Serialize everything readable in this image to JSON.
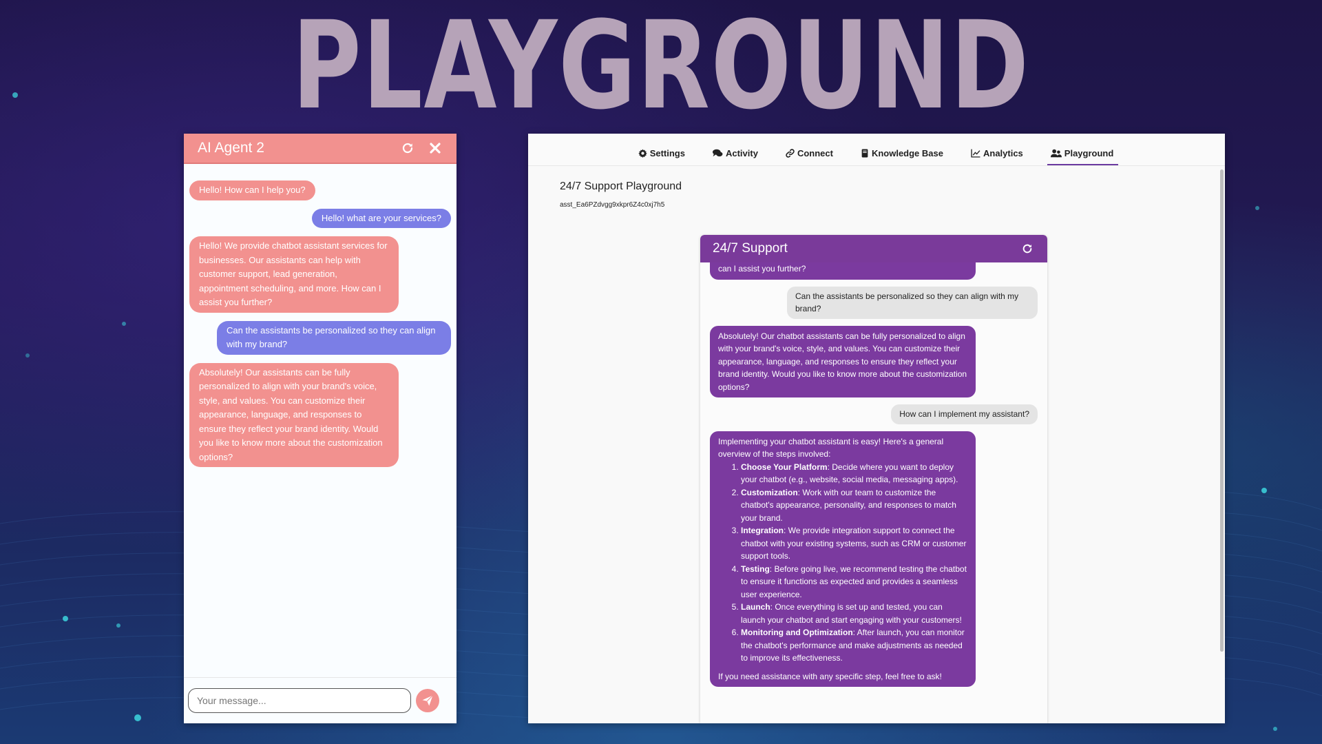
{
  "hero": {
    "title": "PLAYGROUND"
  },
  "agent_widget": {
    "title": "AI Agent 2",
    "refresh_icon": "refresh-icon",
    "close_icon": "close-icon",
    "accent_color": "#f2918f",
    "user_color": "#7b7ee6",
    "messages": [
      {
        "role": "bot",
        "text": "Hello! How can I help you?"
      },
      {
        "role": "user",
        "text": "Hello! what are your services?"
      },
      {
        "role": "bot",
        "text": "Hello! We provide chatbot assistant services for businesses. Our assistants can help with customer support, lead generation, appointment scheduling, and more. How can I assist you further?"
      },
      {
        "role": "user",
        "text": "Can the assistants be personalized so they can align with my brand?"
      },
      {
        "role": "bot",
        "text": "Absolutely! Our assistants can be fully personalized to align with your brand's voice, style, and values. You can customize their appearance, language, and responses to ensure they reflect your brand identity. Would you like to know more about the customization options?"
      }
    ],
    "input_placeholder": "Your message...",
    "send_icon": "send-icon"
  },
  "panel": {
    "nav": [
      {
        "label": "Settings",
        "icon": "gear-icon",
        "active": false
      },
      {
        "label": "Activity",
        "icon": "comments-icon",
        "active": false
      },
      {
        "label": "Connect",
        "icon": "link-icon",
        "active": false
      },
      {
        "label": "Knowledge Base",
        "icon": "book-icon",
        "active": false
      },
      {
        "label": "Analytics",
        "icon": "chart-icon",
        "active": false
      },
      {
        "label": "Playground",
        "icon": "users-icon",
        "active": true
      }
    ],
    "title": "24/7 Support Playground",
    "assistant_id": "asst_Ea6PZdvgg9xkpr6Z4c0xj7h5",
    "accent_color": "#7a3a9a"
  },
  "support_chat": {
    "title": "24/7 Support",
    "refresh_icon": "refresh-icon",
    "partial_message": "can I assist you further?",
    "user_message_1": "Can the assistants be personalized so they can align with my brand?",
    "bot_message_1": "Absolutely! Our chatbot assistants can be fully personalized to align with your brand's voice, style, and values. You can customize their appearance, language, and responses to ensure they reflect your brand identity. Would you like to know more about the customization options?",
    "user_message_2": "How can I implement my assistant?",
    "steps_intro": "Implementing your chatbot assistant is easy! Here's a general overview of the steps involved:",
    "steps": [
      {
        "title": "Choose Your Platform",
        "text": ": Decide where you want to deploy your chatbot (e.g., website, social media, messaging apps)."
      },
      {
        "title": "Customization",
        "text": ": Work with our team to customize the chatbot's appearance, personality, and responses to match your brand."
      },
      {
        "title": "Integration",
        "text": ": We provide integration support to connect the chatbot with your existing systems, such as CRM or customer support tools."
      },
      {
        "title": "Testing",
        "text": ": Before going live, we recommend testing the chatbot to ensure it functions as expected and provides a seamless user experience."
      },
      {
        "title": "Launch",
        "text": ": Once everything is set up and tested, you can launch your chatbot and start engaging with your customers!"
      },
      {
        "title": "Monitoring and Optimization",
        "text": ": After launch, you can monitor the chatbot's performance and make adjustments as needed to improve its effectiveness."
      }
    ],
    "steps_outro": "If you need assistance with any specific step, feel free to ask!"
  }
}
